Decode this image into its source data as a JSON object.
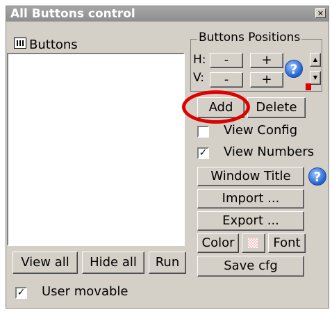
{
  "window": {
    "title": "All Buttons control"
  },
  "buttons_panel": {
    "label": "Buttons"
  },
  "positions": {
    "group_label": "Buttons Positions",
    "h_label": "H:",
    "v_label": "V:",
    "minus": "-",
    "plus": "+"
  },
  "actions": {
    "add": "Add",
    "delete": "Delete",
    "view_config": "View Config",
    "view_numbers": "View Numbers",
    "window_title": "Window Title",
    "import": "Import ...",
    "export": "Export ...",
    "color": "Color",
    "font": "Font",
    "save_cfg": "Save cfg"
  },
  "bottom": {
    "view_all": "View all",
    "hide_all": "Hide all",
    "run": "Run",
    "user_movable": "User movable"
  },
  "checks": {
    "view_config": false,
    "view_numbers": true,
    "user_movable": true
  },
  "colors": {
    "highlight_circle": "#e00000",
    "help_icon": "#1e5fd0"
  }
}
